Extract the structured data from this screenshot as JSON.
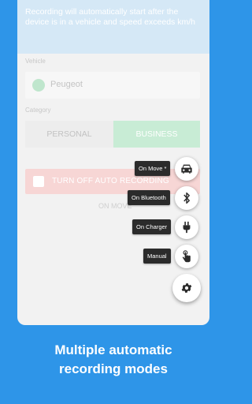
{
  "banner": {
    "text": "Recording will automatically start after the device is in a vehicle and speed exceeds km/h"
  },
  "vehicle": {
    "label": "Vehicle",
    "name": "Peugeot"
  },
  "category": {
    "label": "Category",
    "personal": "PERSONAL",
    "business": "BUSINESS"
  },
  "auto": {
    "turn_off": "TURN OFF AUTO RECORDING",
    "status": "ON MOVE"
  },
  "menu": {
    "items": [
      {
        "label": "On Move *",
        "icon": "car-icon"
      },
      {
        "label": "On Bluetooth",
        "icon": "bluetooth-icon"
      },
      {
        "label": "On Charger",
        "icon": "plug-icon"
      },
      {
        "label": "Manual",
        "icon": "touch-icon"
      }
    ],
    "settings_icon": "gear-icon"
  },
  "caption": {
    "line1": "Multiple automatic",
    "line2": "recording modes"
  },
  "colors": {
    "background": "#2e95e8",
    "accent_green": "#c8ecd5",
    "danger_light": "#f7d6d5",
    "tag": "#2b2b2b"
  }
}
